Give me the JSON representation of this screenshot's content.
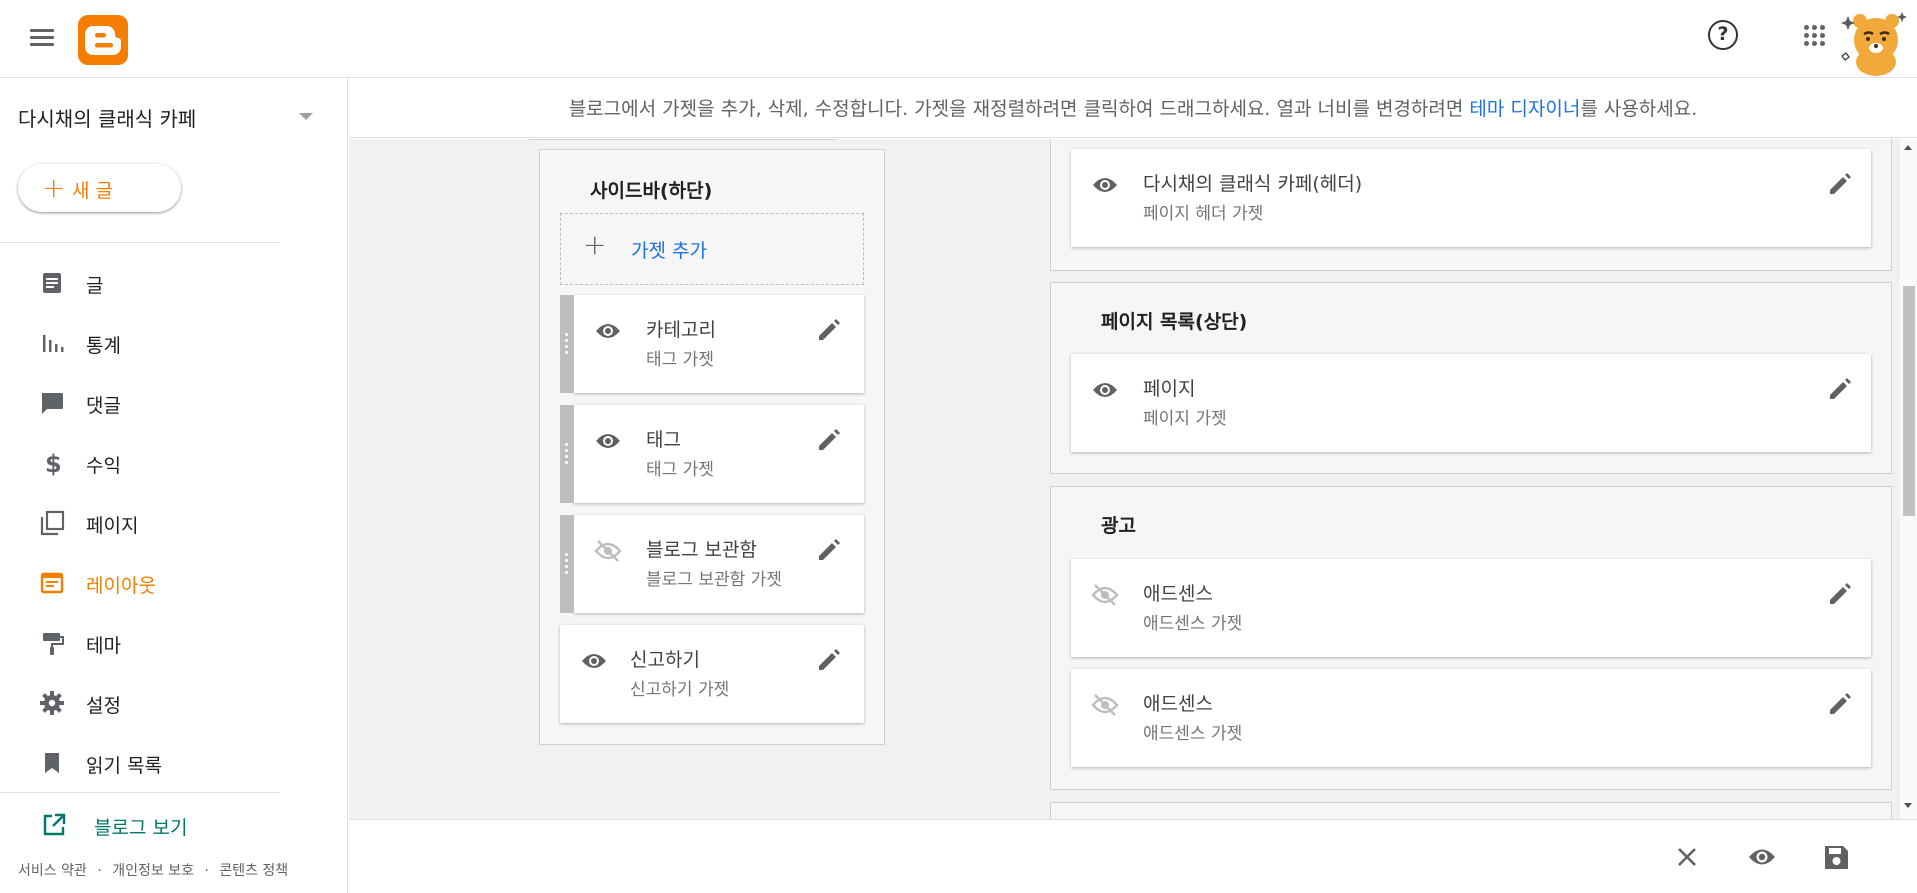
{
  "app": {
    "colors": {
      "accent": "#f57d00",
      "link": "#1a73e8",
      "teal": "#00796b"
    },
    "help_label": "?"
  },
  "sidebar": {
    "blog_name": "다시채의 클래식 카페",
    "new_post_label": "새 글",
    "new_post_plus": "+",
    "items": [
      {
        "label": "글",
        "icon": "posts-icon"
      },
      {
        "label": "통계",
        "icon": "stats-icon"
      },
      {
        "label": "댓글",
        "icon": "comments-icon"
      },
      {
        "label": "수익",
        "icon": "dollar-icon"
      },
      {
        "label": "페이지",
        "icon": "pages-icon"
      },
      {
        "label": "레이아웃",
        "icon": "layout-icon",
        "active": true
      },
      {
        "label": "테마",
        "icon": "theme-icon"
      },
      {
        "label": "설정",
        "icon": "gear-icon"
      },
      {
        "label": "읽기 목록",
        "icon": "bookmark-icon"
      }
    ],
    "view_blog_label": "블로그 보기",
    "footer": {
      "terms": "서비스 약관",
      "privacy": "개인정보 보호",
      "content": "콘텐츠 정책",
      "sep": "·"
    }
  },
  "notice": {
    "text_before": "블로그에서 가젯을 추가, 삭제, 수정합니다. 가젯을 재정렬하려면 클릭하여 드래그하세요. 열과 너비를 변경하려면 ",
    "link_text": "테마 디자이너",
    "text_after": "를 사용하세요."
  },
  "left_section": {
    "title": "사이드바(하단)",
    "add_label": "가젯 추가",
    "add_plus": "+",
    "gadgets": [
      {
        "title": "카테고리",
        "subtitle": "태그 가젯",
        "visible": true,
        "draggable": true
      },
      {
        "title": "태그",
        "subtitle": "태그 가젯",
        "visible": true,
        "draggable": true
      },
      {
        "title": "블로그 보관함",
        "subtitle": "블로그 보관함 가젯",
        "visible": false,
        "draggable": true
      },
      {
        "title": "신고하기",
        "subtitle": "신고하기 가젯",
        "visible": true,
        "draggable": false
      }
    ]
  },
  "right_sections": {
    "header_gadget": {
      "title": "다시채의 클래식 카페(헤더)",
      "subtitle": "페이지 헤더 가젯",
      "visible": true
    },
    "pages_section": {
      "title": "페이지 목록(상단)",
      "gadget": {
        "title": "페이지",
        "subtitle": "페이지 가젯",
        "visible": true
      }
    },
    "ads_section": {
      "title": "광고",
      "gadgets": [
        {
          "title": "애드센스",
          "subtitle": "애드센스 가젯",
          "visible": false
        },
        {
          "title": "애드센스",
          "subtitle": "애드센스 가젯",
          "visible": false
        }
      ]
    }
  },
  "bottom_bar": {
    "close": "close-icon",
    "preview": "eye-icon",
    "save": "save-icon"
  }
}
